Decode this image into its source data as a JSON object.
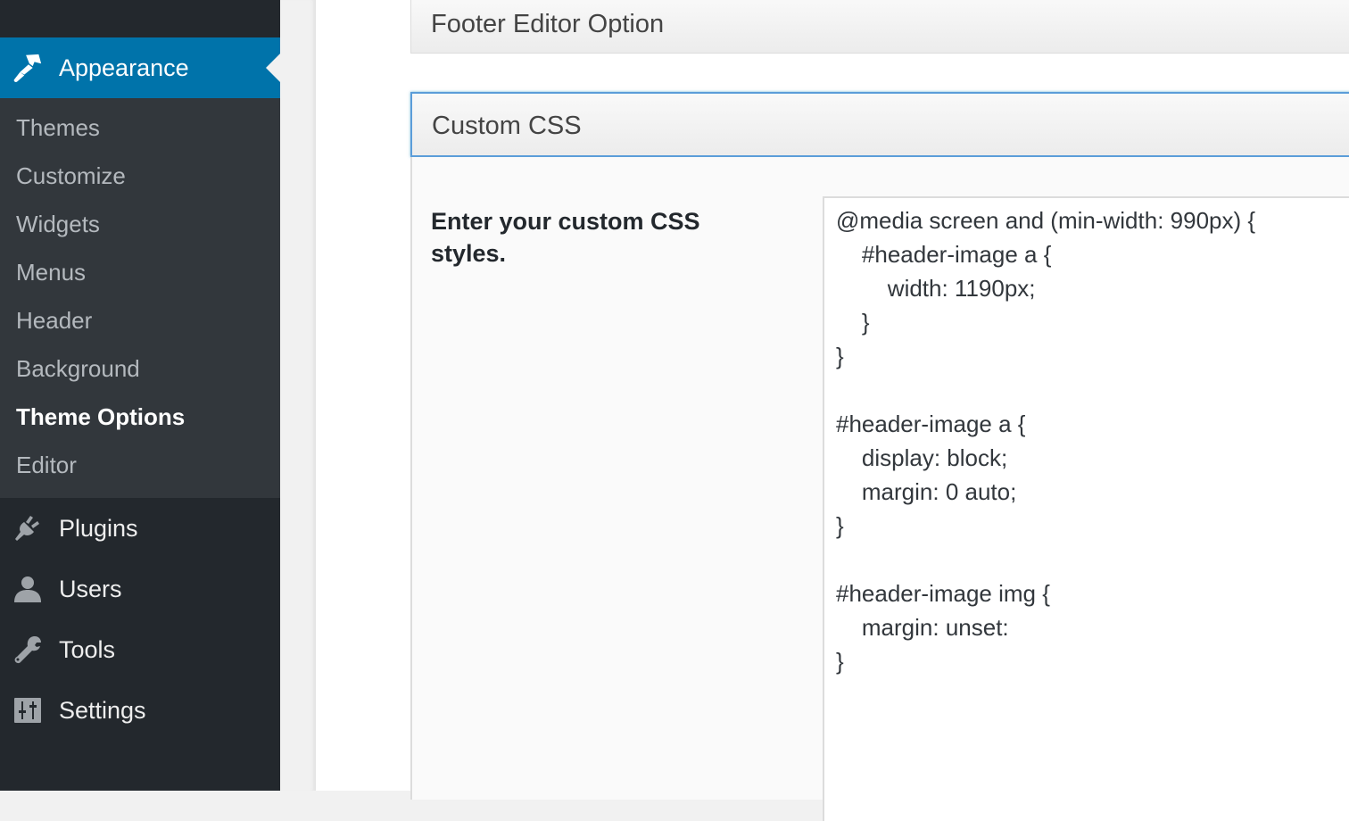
{
  "sidebar": {
    "current_menu": {
      "label": "Appearance",
      "icon": "paintbrush-icon"
    },
    "submenu": [
      {
        "label": "Themes",
        "current": false
      },
      {
        "label": "Customize",
        "current": false
      },
      {
        "label": "Widgets",
        "current": false
      },
      {
        "label": "Menus",
        "current": false
      },
      {
        "label": "Header",
        "current": false
      },
      {
        "label": "Background",
        "current": false
      },
      {
        "label": "Theme Options",
        "current": true
      },
      {
        "label": "Editor",
        "current": false
      }
    ],
    "menu_items": [
      {
        "label": "Plugins",
        "icon": "plugin-icon"
      },
      {
        "label": "Users",
        "icon": "user-icon"
      },
      {
        "label": "Tools",
        "icon": "wrench-icon"
      },
      {
        "label": "Settings",
        "icon": "settings-sliders-icon"
      }
    ]
  },
  "content": {
    "sections": [
      {
        "title": "Footer Editor Option"
      },
      {
        "title": "Custom CSS"
      }
    ],
    "custom_css": {
      "label": "Enter your custom CSS styles.",
      "lines": [
        "@media screen and (min-width: 990px) {",
        "    #header-image a {",
        "        width: 1190px;",
        "    }",
        "}",
        "",
        "#header-image a {",
        "    display: block;",
        "    margin: 0 auto;",
        "}",
        "",
        "#header-image img {",
        "    margin: unset:",
        "}"
      ]
    }
  },
  "colors": {
    "sidebar_bg": "#23282d",
    "submenu_bg": "#32373c",
    "accent": "#0073aa",
    "focus_border": "#5b9dd9"
  }
}
